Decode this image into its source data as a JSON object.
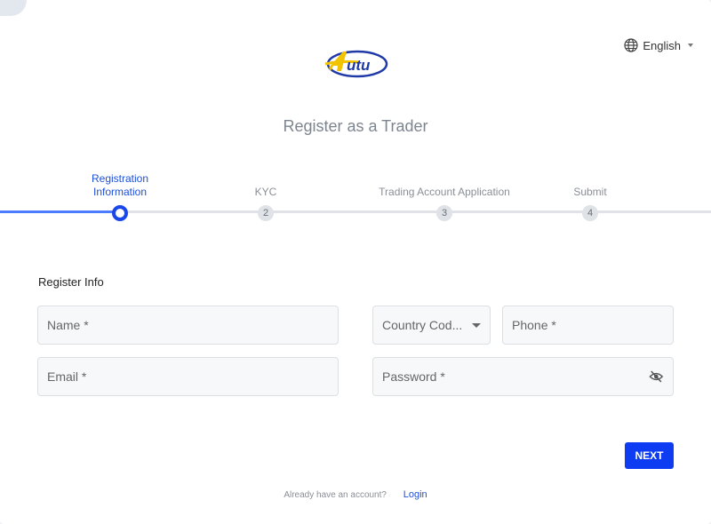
{
  "header": {
    "brand_icon": "autu-logo",
    "language_label": "English",
    "language_icon": "globe-icon",
    "page_title": "Register as a Trader"
  },
  "stepper": {
    "progress_fraction": 0.17,
    "steps": [
      {
        "label": "Registration Information",
        "number": "",
        "state": "active"
      },
      {
        "label": "KYC",
        "number": "2",
        "state": "pending"
      },
      {
        "label": "Trading Account Application",
        "number": "3",
        "state": "pending"
      },
      {
        "label": "Submit",
        "number": "4",
        "state": "pending"
      }
    ]
  },
  "form": {
    "section_title": "Register Info",
    "name_placeholder": "Name *",
    "country_code_placeholder": "Country Cod...",
    "phone_placeholder": "Phone *",
    "email_placeholder": "Email *",
    "password_placeholder": "Password *",
    "password_toggle_icon": "eye-off-icon",
    "next_label": "NEXT"
  },
  "footer": {
    "prompt": "Already have an account?",
    "login_label": "Login"
  },
  "colors": {
    "primary": "#0d3cf2",
    "active_step": "#1a47e8",
    "title_gray": "#7d8590"
  }
}
